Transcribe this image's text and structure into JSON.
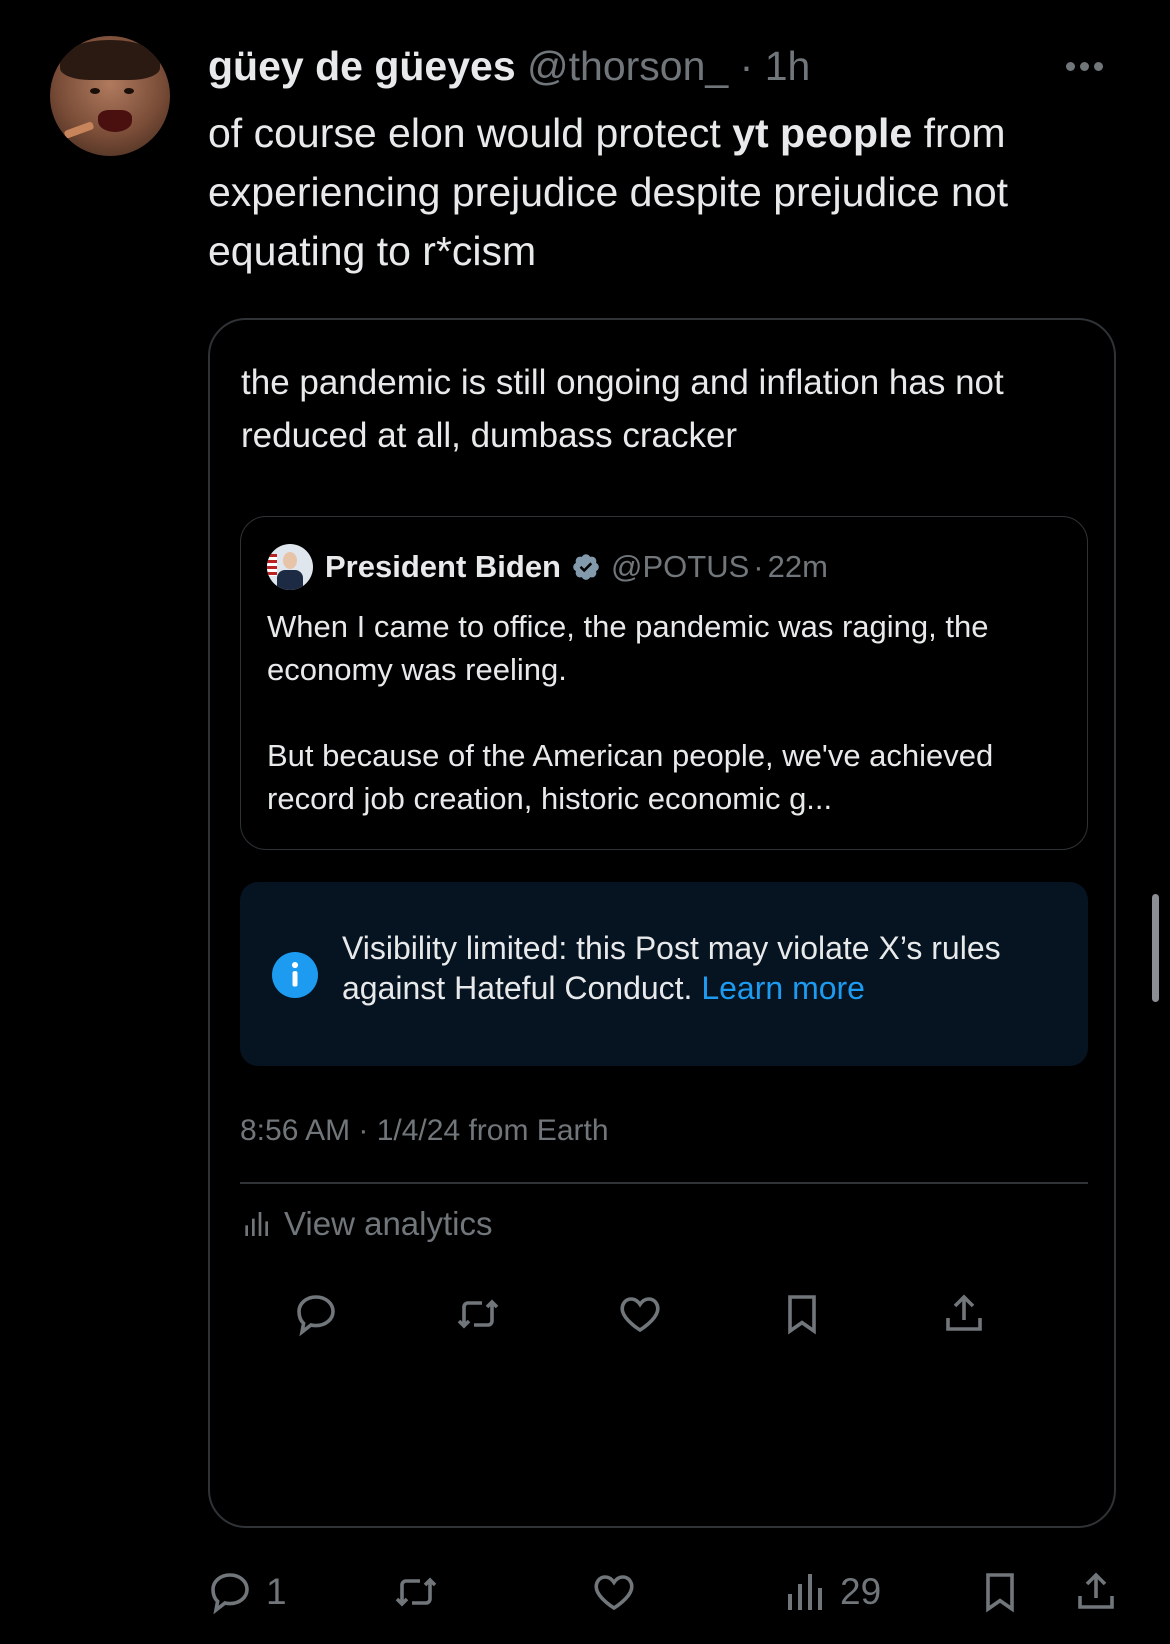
{
  "post": {
    "display_name": "güey de güeyes",
    "handle": "@thorson_",
    "separator": "·",
    "time": "1h",
    "text_before": "of course elon would protect ",
    "text_bold": "yt people",
    "text_after": " from experiencing prejudice despite prejudice not equating to r*cism"
  },
  "quoted_post": {
    "text": "the pandemic is still ongoing and inflation has not reduced at all, dumbass cracker",
    "inner_quote": {
      "display_name": "President Biden",
      "handle": "@POTUS",
      "separator": "·",
      "time": "22m",
      "paragraph1": "When I came to office, the pandemic was raging, the economy was reeling.",
      "paragraph2": "But because of the American people, we've achieved record job creation, historic economic g..."
    },
    "notice": {
      "text": "Visibility limited: this Post may violate X’s rules against Hateful Conduct. ",
      "link": "Learn more"
    },
    "timestamp": "8:56 AM · 1/4/24 from Earth",
    "analytics_label": "View analytics"
  },
  "actions": {
    "reply_count": "1",
    "views_count": "29"
  },
  "colors": {
    "background": "#000000",
    "text": "#e7e9ea",
    "muted": "#71767b",
    "accent": "#1d9bf0",
    "border": "#2f3336",
    "notice_bg": "#061320"
  },
  "icons": [
    "more-icon",
    "verified-badge-icon",
    "info-icon",
    "analytics-icon",
    "reply-icon",
    "repost-icon",
    "like-icon",
    "bookmark-icon",
    "share-icon"
  ]
}
